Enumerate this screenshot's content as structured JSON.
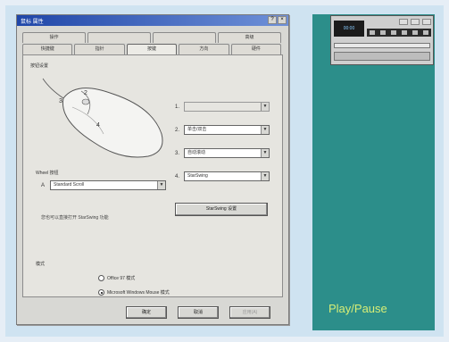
{
  "dialog": {
    "title": "鼠标 属性",
    "tabs_row1": [
      "操作",
      "",
      "",
      "高级"
    ],
    "tabs_row2": [
      "快捷键",
      "指针",
      "按键",
      "方向",
      "硬件"
    ],
    "active_tab_index": 2,
    "buttons_group_label": "按钮设置",
    "button_assignments": [
      {
        "num": "1.",
        "value": "",
        "disabled": true
      },
      {
        "num": "2.",
        "value": "单击/双击",
        "disabled": false
      },
      {
        "num": "3.",
        "value": "自动滚动",
        "disabled": false
      },
      {
        "num": "4.",
        "value": "StarSwing",
        "disabled": false
      }
    ],
    "wheel_label": "Wheel 按钮",
    "wheel_row": {
      "num": "A",
      "value": "Standard Scroll"
    },
    "hint": "您也可以直接打开 StarSwing 功能",
    "starswing_button": "StarSwing 设置",
    "mode_label": "模式",
    "modes": [
      {
        "label": "Office 97 模式",
        "checked": false
      },
      {
        "label": "Microsoft Windows Mouse 模式",
        "checked": true
      }
    ],
    "footer": {
      "ok": "确定",
      "cancel": "取消",
      "apply": "应用(A)"
    }
  },
  "player": {
    "lcd_text": "00:00",
    "caption": "Play/Pause"
  },
  "colors": {
    "teal": "#2c8e8a",
    "caption": "#d7ee76",
    "titlebar": "#1f46a8"
  }
}
